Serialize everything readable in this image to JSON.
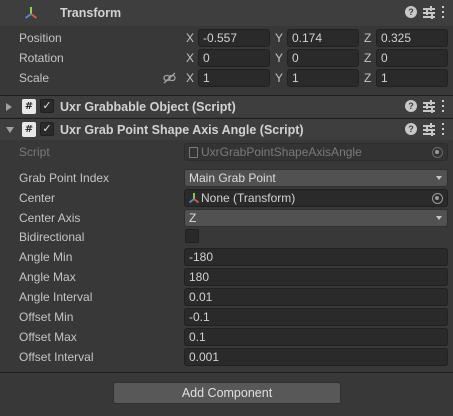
{
  "transform": {
    "title": "Transform",
    "icon": "transform-axes-icon",
    "position": {
      "label": "Position",
      "x": "-0.557",
      "y": "0.174",
      "z": "0.325"
    },
    "rotation": {
      "label": "Rotation",
      "x": "0",
      "y": "0",
      "z": "0"
    },
    "scale": {
      "label": "Scale",
      "x": "1",
      "y": "1",
      "z": "1"
    },
    "axis_labels": {
      "x": "X",
      "y": "Y",
      "z": "Z"
    }
  },
  "grabbable": {
    "title": "Uxr Grabbable Object (Script)",
    "enabled": true
  },
  "shape_axis": {
    "title": "Uxr Grab Point Shape Axis Angle (Script)",
    "enabled": true,
    "script": {
      "label": "Script",
      "value": "UxrGrabPointShapeAxisAngle"
    },
    "grab_point_index": {
      "label": "Grab Point Index",
      "value": "Main Grab Point"
    },
    "center": {
      "label": "Center",
      "value": "None (Transform)"
    },
    "center_axis": {
      "label": "Center Axis",
      "value": "Z"
    },
    "bidirectional": {
      "label": "Bidirectional",
      "checked": false
    },
    "angle_min": {
      "label": "Angle Min",
      "value": "-180"
    },
    "angle_max": {
      "label": "Angle Max",
      "value": "180"
    },
    "angle_interval": {
      "label": "Angle Interval",
      "value": "0.01"
    },
    "offset_min": {
      "label": "Offset Min",
      "value": "-0.1"
    },
    "offset_max": {
      "label": "Offset Max",
      "value": "0.1"
    },
    "offset_interval": {
      "label": "Offset Interval",
      "value": "0.001"
    }
  },
  "add_component": {
    "label": "Add Component"
  },
  "colors": {
    "background": "#383838",
    "header": "#3e3e3e",
    "field": "#2a2a2a",
    "dropdown": "#515151",
    "axis_red": "#e0544a",
    "axis_green": "#8cd94a",
    "axis_blue": "#4a8ae0"
  }
}
